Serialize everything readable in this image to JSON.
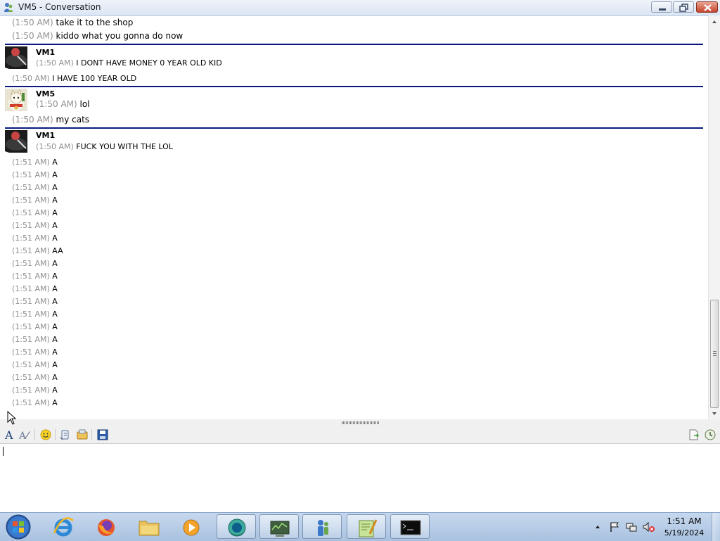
{
  "window": {
    "title": "VM5 - Conversation"
  },
  "messages": [
    {
      "ts": "(1:50 AM)",
      "text": "take it to the shop"
    },
    {
      "ts": "(1:50 AM)",
      "text": "kiddo what you gonna do now"
    },
    {
      "ts": "(1:50 AM)",
      "text": "I DONT HAVE MONEY 0 YEAR OLD KID"
    },
    {
      "ts": "(1:50 AM)",
      "text": "I HAVE 100 YEAR OLD"
    },
    {
      "ts": "(1:50 AM)",
      "text": "lol"
    },
    {
      "ts": "(1:50 AM)",
      "text": "my cats"
    },
    {
      "ts": "(1:50 AM)",
      "text": "FUCK YOU WITH THE LOL"
    }
  ],
  "senders": [
    "VM1",
    "VM5",
    "VM1"
  ],
  "a_messages": [
    {
      "ts": "(1:51 AM)",
      "text": "A"
    },
    {
      "ts": "(1:51 AM)",
      "text": "A"
    },
    {
      "ts": "(1:51 AM)",
      "text": "A"
    },
    {
      "ts": "(1:51 AM)",
      "text": "A"
    },
    {
      "ts": "(1:51 AM)",
      "text": "A"
    },
    {
      "ts": "(1:51 AM)",
      "text": "A"
    },
    {
      "ts": "(1:51 AM)",
      "text": "A"
    },
    {
      "ts": "(1:51 AM)",
      "text": "AA"
    },
    {
      "ts": "(1:51 AM)",
      "text": "A"
    },
    {
      "ts": "(1:51 AM)",
      "text": "A"
    },
    {
      "ts": "(1:51 AM)",
      "text": "A"
    },
    {
      "ts": "(1:51 AM)",
      "text": "A"
    },
    {
      "ts": "(1:51 AM)",
      "text": "A"
    },
    {
      "ts": "(1:51 AM)",
      "text": "A"
    },
    {
      "ts": "(1:51 AM)",
      "text": "A"
    },
    {
      "ts": "(1:51 AM)",
      "text": "A"
    },
    {
      "ts": "(1:51 AM)",
      "text": "A"
    },
    {
      "ts": "(1:51 AM)",
      "text": "A"
    },
    {
      "ts": "(1:51 AM)",
      "text": "A"
    },
    {
      "ts": "(1:51 AM)",
      "text": "A"
    }
  ],
  "toolbar": {
    "icons": [
      "font-icon",
      "font-color-icon",
      "emoticon-icon",
      "nudge-icon",
      "wink-icon",
      "save-icon",
      "send-file-icon",
      "history-icon"
    ]
  },
  "input": {
    "value": ""
  },
  "clock": {
    "time": "1:51 AM",
    "date": "5/19/2024"
  },
  "taskbar": {
    "apps": [
      "internet-explorer",
      "firefox",
      "file-explorer",
      "media-player",
      "messenger",
      "system-monitor",
      "network-people",
      "notepad-plus-plus",
      "command-prompt"
    ]
  },
  "colors": {
    "divider": "#0a1a7c",
    "timestamp": "#8f8f8f",
    "titlebar": "#dbe6f4",
    "taskbar": "#b7cde8"
  }
}
